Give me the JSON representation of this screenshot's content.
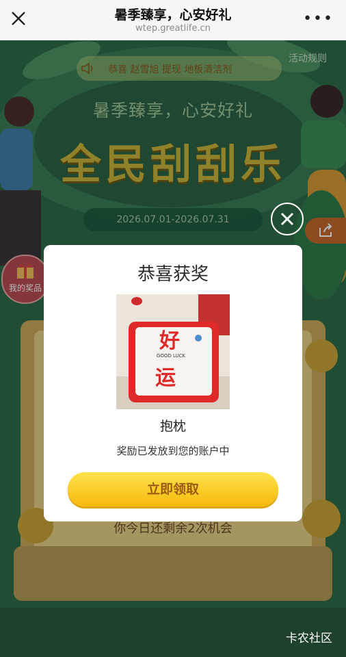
{
  "browser": {
    "title": "暑季臻享，心安好礼",
    "url": "wtep.greatlife.cn",
    "more": "•••"
  },
  "page": {
    "marquee_text": "恭喜 赵雪旭 提现 地板清洁剂",
    "rules_label": "活动规则",
    "subtitle": "暑季臻享，心安好礼",
    "main_title": "全民刮刮乐",
    "date_range": "2026.07.01-2026.07.31",
    "my_prize_label": "我的奖品",
    "remaining_text": "你今日还剩余2次机会",
    "watermark": "卡农社区"
  },
  "modal": {
    "title": "恭喜获奖",
    "prize_name": "抱枕",
    "prize_desc": "奖励已发放到您的账户中",
    "claim_button": "立即领取",
    "pillow_big_text_1": "好",
    "pillow_big_text_2": "运",
    "pillow_small_text": "GOOD LUCK"
  },
  "colors": {
    "accent_yellow": "#f6b80d",
    "bg_green": "#2f6b4a",
    "pillow_red": "#e02a2a"
  }
}
